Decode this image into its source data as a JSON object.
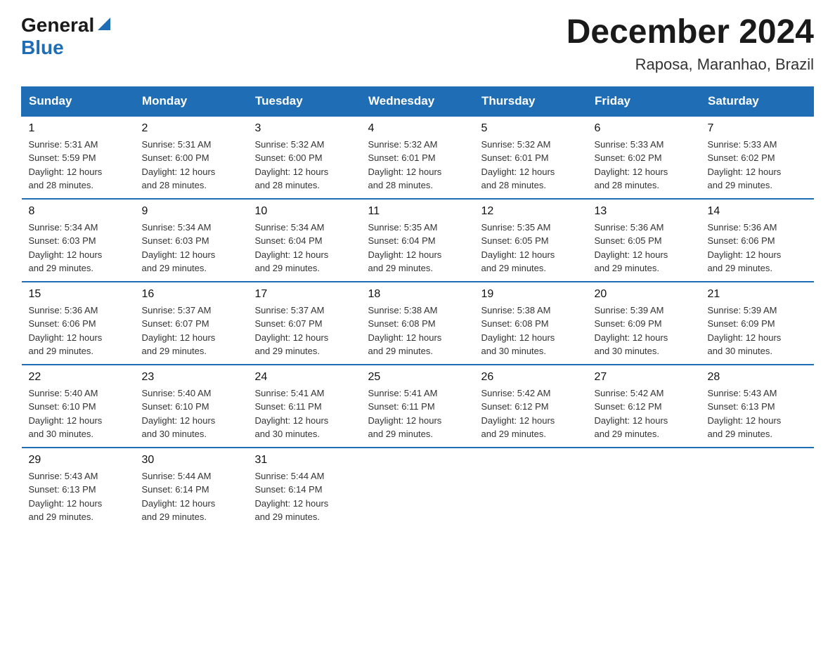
{
  "header": {
    "logo_general": "General",
    "logo_blue": "Blue",
    "title": "December 2024",
    "subtitle": "Raposa, Maranhao, Brazil"
  },
  "days_of_week": [
    "Sunday",
    "Monday",
    "Tuesday",
    "Wednesday",
    "Thursday",
    "Friday",
    "Saturday"
  ],
  "weeks": [
    [
      {
        "day": "1",
        "sunrise": "5:31 AM",
        "sunset": "5:59 PM",
        "daylight": "12 hours and 28 minutes."
      },
      {
        "day": "2",
        "sunrise": "5:31 AM",
        "sunset": "6:00 PM",
        "daylight": "12 hours and 28 minutes."
      },
      {
        "day": "3",
        "sunrise": "5:32 AM",
        "sunset": "6:00 PM",
        "daylight": "12 hours and 28 minutes."
      },
      {
        "day": "4",
        "sunrise": "5:32 AM",
        "sunset": "6:01 PM",
        "daylight": "12 hours and 28 minutes."
      },
      {
        "day": "5",
        "sunrise": "5:32 AM",
        "sunset": "6:01 PM",
        "daylight": "12 hours and 28 minutes."
      },
      {
        "day": "6",
        "sunrise": "5:33 AM",
        "sunset": "6:02 PM",
        "daylight": "12 hours and 28 minutes."
      },
      {
        "day": "7",
        "sunrise": "5:33 AM",
        "sunset": "6:02 PM",
        "daylight": "12 hours and 29 minutes."
      }
    ],
    [
      {
        "day": "8",
        "sunrise": "5:34 AM",
        "sunset": "6:03 PM",
        "daylight": "12 hours and 29 minutes."
      },
      {
        "day": "9",
        "sunrise": "5:34 AM",
        "sunset": "6:03 PM",
        "daylight": "12 hours and 29 minutes."
      },
      {
        "day": "10",
        "sunrise": "5:34 AM",
        "sunset": "6:04 PM",
        "daylight": "12 hours and 29 minutes."
      },
      {
        "day": "11",
        "sunrise": "5:35 AM",
        "sunset": "6:04 PM",
        "daylight": "12 hours and 29 minutes."
      },
      {
        "day": "12",
        "sunrise": "5:35 AM",
        "sunset": "6:05 PM",
        "daylight": "12 hours and 29 minutes."
      },
      {
        "day": "13",
        "sunrise": "5:36 AM",
        "sunset": "6:05 PM",
        "daylight": "12 hours and 29 minutes."
      },
      {
        "day": "14",
        "sunrise": "5:36 AM",
        "sunset": "6:06 PM",
        "daylight": "12 hours and 29 minutes."
      }
    ],
    [
      {
        "day": "15",
        "sunrise": "5:36 AM",
        "sunset": "6:06 PM",
        "daylight": "12 hours and 29 minutes."
      },
      {
        "day": "16",
        "sunrise": "5:37 AM",
        "sunset": "6:07 PM",
        "daylight": "12 hours and 29 minutes."
      },
      {
        "day": "17",
        "sunrise": "5:37 AM",
        "sunset": "6:07 PM",
        "daylight": "12 hours and 29 minutes."
      },
      {
        "day": "18",
        "sunrise": "5:38 AM",
        "sunset": "6:08 PM",
        "daylight": "12 hours and 29 minutes."
      },
      {
        "day": "19",
        "sunrise": "5:38 AM",
        "sunset": "6:08 PM",
        "daylight": "12 hours and 30 minutes."
      },
      {
        "day": "20",
        "sunrise": "5:39 AM",
        "sunset": "6:09 PM",
        "daylight": "12 hours and 30 minutes."
      },
      {
        "day": "21",
        "sunrise": "5:39 AM",
        "sunset": "6:09 PM",
        "daylight": "12 hours and 30 minutes."
      }
    ],
    [
      {
        "day": "22",
        "sunrise": "5:40 AM",
        "sunset": "6:10 PM",
        "daylight": "12 hours and 30 minutes."
      },
      {
        "day": "23",
        "sunrise": "5:40 AM",
        "sunset": "6:10 PM",
        "daylight": "12 hours and 30 minutes."
      },
      {
        "day": "24",
        "sunrise": "5:41 AM",
        "sunset": "6:11 PM",
        "daylight": "12 hours and 30 minutes."
      },
      {
        "day": "25",
        "sunrise": "5:41 AM",
        "sunset": "6:11 PM",
        "daylight": "12 hours and 29 minutes."
      },
      {
        "day": "26",
        "sunrise": "5:42 AM",
        "sunset": "6:12 PM",
        "daylight": "12 hours and 29 minutes."
      },
      {
        "day": "27",
        "sunrise": "5:42 AM",
        "sunset": "6:12 PM",
        "daylight": "12 hours and 29 minutes."
      },
      {
        "day": "28",
        "sunrise": "5:43 AM",
        "sunset": "6:13 PM",
        "daylight": "12 hours and 29 minutes."
      }
    ],
    [
      {
        "day": "29",
        "sunrise": "5:43 AM",
        "sunset": "6:13 PM",
        "daylight": "12 hours and 29 minutes."
      },
      {
        "day": "30",
        "sunrise": "5:44 AM",
        "sunset": "6:14 PM",
        "daylight": "12 hours and 29 minutes."
      },
      {
        "day": "31",
        "sunrise": "5:44 AM",
        "sunset": "6:14 PM",
        "daylight": "12 hours and 29 minutes."
      },
      null,
      null,
      null,
      null
    ]
  ],
  "labels": {
    "sunrise": "Sunrise:",
    "sunset": "Sunset:",
    "daylight": "Daylight:"
  }
}
